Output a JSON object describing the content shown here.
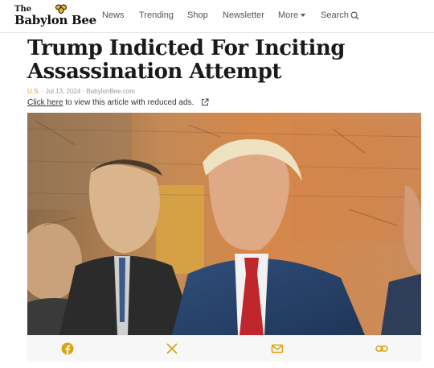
{
  "site": {
    "logo_line1": "The",
    "logo_line2": "Babylon Bee"
  },
  "nav": {
    "items": [
      "News",
      "Trending",
      "Shop",
      "Newsletter",
      "More"
    ],
    "search_label": "Search"
  },
  "article": {
    "title": "Trump Indicted For Inciting Assassination Attempt",
    "category": "U.S.",
    "separator": "·",
    "date": "Jul 13, 2024",
    "source": "BabylonBee.com",
    "reduced_ads_link": "Click here",
    "reduced_ads_text": " to view this article with reduced ads."
  },
  "share": {
    "buttons": [
      "facebook-icon",
      "x-icon",
      "email-icon",
      "copy-link-icon"
    ]
  },
  "colors": {
    "accent": "#d9a416",
    "share_icon": "#d9a416",
    "background": "#ffffff"
  }
}
